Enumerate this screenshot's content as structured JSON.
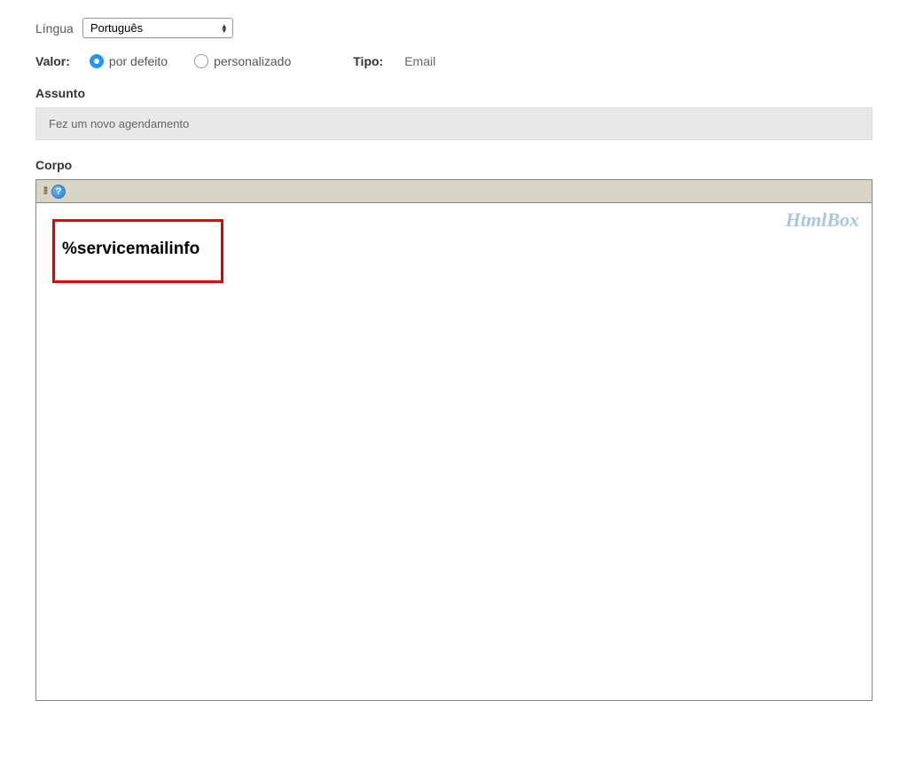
{
  "language": {
    "label": "Língua",
    "selected": "Português"
  },
  "valor": {
    "label": "Valor:",
    "options": {
      "default": "por defeito",
      "custom": "personalizado"
    }
  },
  "tipo": {
    "label": "Tipo:",
    "value": "Email"
  },
  "assunto": {
    "label": "Assunto",
    "value": "Fez um novo agendamento"
  },
  "corpo": {
    "label": "Corpo",
    "editor_brand": "HtmlBox",
    "content_variable": "%servicemailinfo"
  }
}
